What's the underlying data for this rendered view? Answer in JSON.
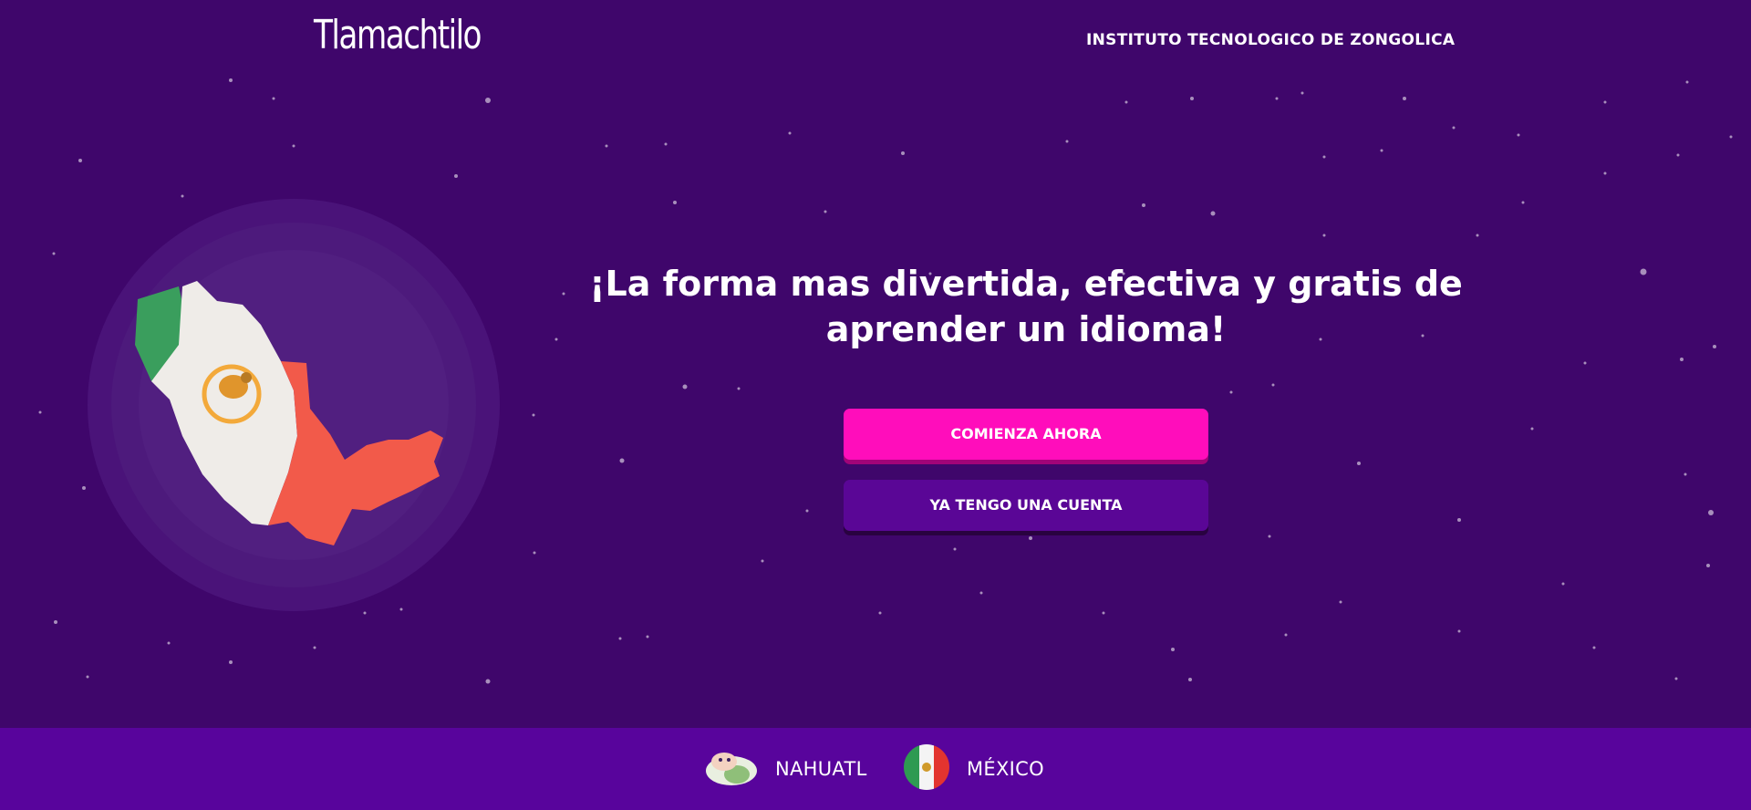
{
  "header": {
    "logo_text": "Tlamachtilo",
    "institute": "INSTITUTO TECNOLOGICO DE ZONGOLICA"
  },
  "hero": {
    "headline": "¡La forma mas divertida, efectiva y gratis de aprender un idioma!",
    "start_button": "COMIENZA AHORA",
    "account_button": "YA TENGO UNA CUENTA"
  },
  "footer": {
    "languages": [
      {
        "label": "NAHUATL",
        "icon": "tortilla-icon"
      },
      {
        "label": "MÉXICO",
        "icon": "mexico-flag-icon"
      }
    ]
  },
  "colors": {
    "background": "#3f066b",
    "footer": "#58049c",
    "primary_button": "#ff0dbb",
    "secondary_button": "#5a0696"
  }
}
